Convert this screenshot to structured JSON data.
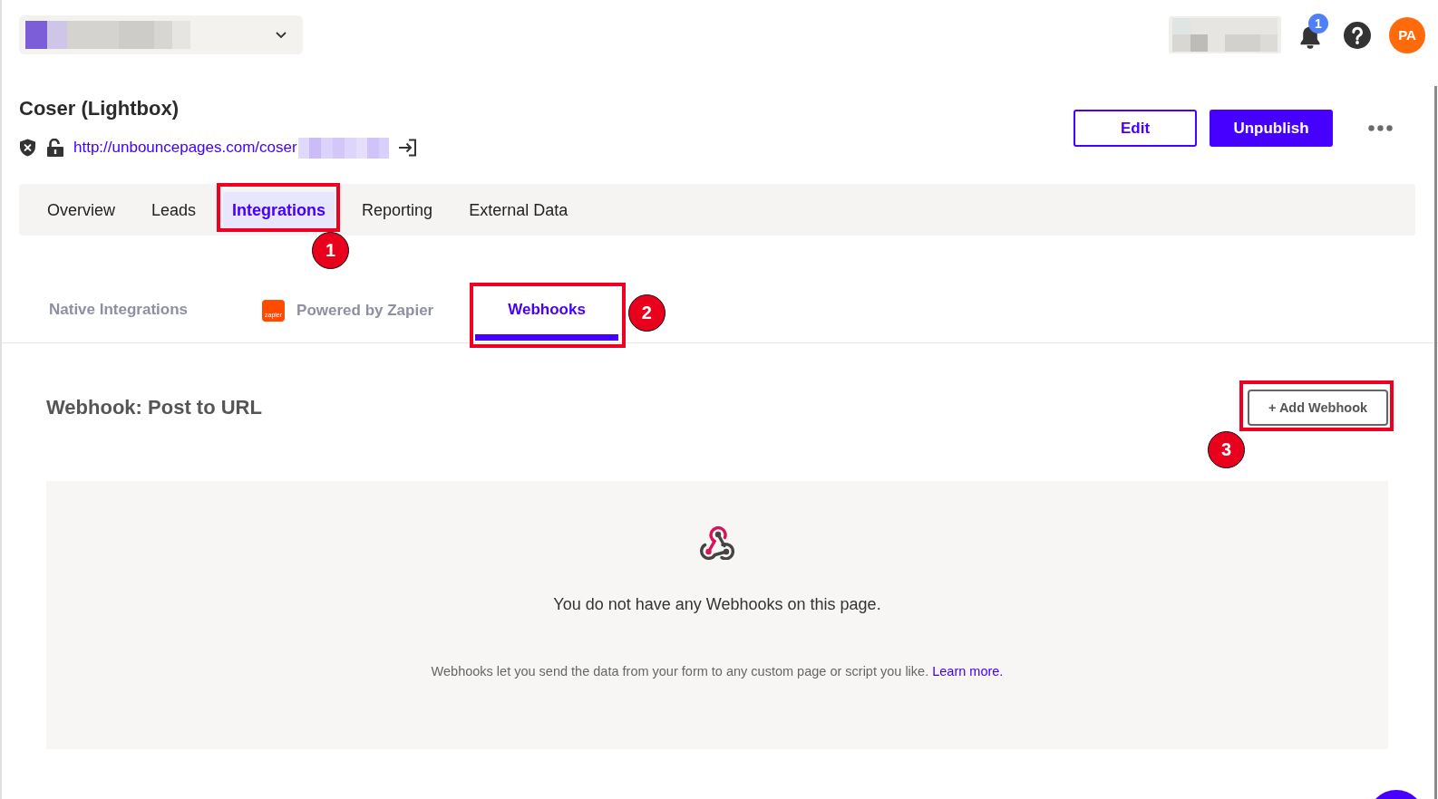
{
  "header": {
    "notification_count": "1",
    "avatar_initials": "PA"
  },
  "page": {
    "title": "Coser (Lightbox)",
    "url": "http://unbouncepages.com/coser",
    "actions": [
      {
        "label": "Edit",
        "kind": "secondary"
      },
      {
        "label": "Unpublish",
        "kind": "primary"
      }
    ]
  },
  "tabs": [
    {
      "label": "Overview",
      "selected": false
    },
    {
      "label": "Leads",
      "selected": false
    },
    {
      "label": "Integrations",
      "selected": true,
      "callout": "1"
    },
    {
      "label": "Reporting",
      "selected": false
    },
    {
      "label": "External Data",
      "selected": false
    }
  ],
  "subtabs": [
    {
      "label": "Native Integrations",
      "selected": false
    },
    {
      "label": "Powered by Zapier",
      "selected": false,
      "logo_text": "zapier"
    },
    {
      "label": "Webhooks",
      "selected": true,
      "callout": "2"
    }
  ],
  "webhooks_section": {
    "title": "Webhook: Post to URL",
    "add_button": {
      "label": "+ Add Webhook",
      "callout": "3"
    }
  },
  "empty_state": {
    "message": "You do not have any Webhooks on this page.",
    "description": "Webhooks let you send the data from your form to any custom page or script you like.",
    "link": "Learn more."
  }
}
